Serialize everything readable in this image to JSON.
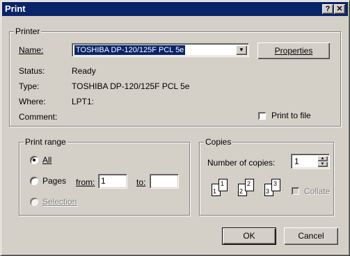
{
  "window": {
    "title": "Print",
    "help_glyph": "?",
    "close_glyph": "✕"
  },
  "printer": {
    "legend": "Printer",
    "name_label": "Name:",
    "name_value": "TOSHIBA DP-120/125F PCL 5e",
    "properties_button": "Properties",
    "status_label": "Status:",
    "status_value": "Ready",
    "type_label": "Type:",
    "type_value": "TOSHIBA DP-120/125F PCL 5e",
    "where_label": "Where:",
    "where_value": "LPT1:",
    "comment_label": "Comment:",
    "print_to_file_label": "Print to file"
  },
  "print_range": {
    "legend": "Print range",
    "all_label": "All",
    "pages_label": "Pages",
    "from_label": "from:",
    "from_value": "1",
    "to_label": "to:",
    "to_value": "",
    "selection_label": "Selection",
    "selected": "All"
  },
  "copies": {
    "legend": "Copies",
    "number_label": "Number of copies:",
    "number_value": "1",
    "collate_label": "Collate",
    "collate_pages": [
      "1",
      "1",
      "2",
      "2",
      "3",
      "3"
    ]
  },
  "buttons": {
    "ok": "OK",
    "cancel": "Cancel"
  },
  "icons": {
    "dropdown": "chevron-down-icon",
    "spin_up": "arrow-up-icon",
    "spin_down": "arrow-down-icon"
  }
}
